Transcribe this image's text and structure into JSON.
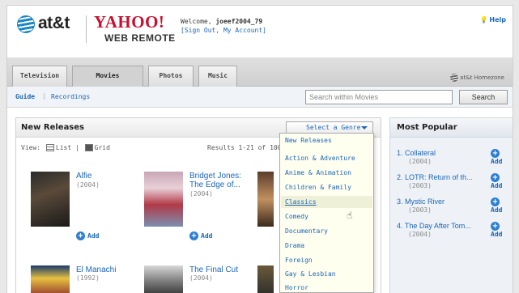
{
  "header": {
    "att_logo": "at&t",
    "yahoo_logo": "YAHOO!",
    "product": "WEB REMOTE",
    "welcome_prefix": "Welcome, ",
    "username": "joeef2004_79",
    "account_links": "[Sign Out, My Account]",
    "help": "Help"
  },
  "tabs": [
    {
      "label": "Television"
    },
    {
      "label": "Movies"
    },
    {
      "label": "Photos"
    },
    {
      "label": "Music"
    }
  ],
  "homezone": "at&t Homezone",
  "subnav": {
    "guide": "Guide",
    "separator": "|",
    "recordings": "Recordings",
    "search_placeholder": "Search within Movies",
    "search_button": "Search"
  },
  "releases": {
    "title": "New Releases",
    "genre_button": "Select a Genre",
    "view_label": "View:",
    "list_label": "List",
    "grid_label": "Grid",
    "results": "Results 1-21 of 100",
    "add_label": "Add",
    "movies": [
      {
        "title": "Alfie",
        "year": "(2004)"
      },
      {
        "title": "Bridget Jones: The Edge of...",
        "year": "(2004)"
      },
      {
        "title": "El Manachi",
        "year": "(1992)"
      },
      {
        "title": "The Final Cut",
        "year": "(2004)"
      }
    ]
  },
  "genres": {
    "items": [
      "New Releases",
      "Action & Adventure",
      "Anime & Animation",
      "Children & Family",
      "Classics",
      "Comedy",
      "Documentary",
      "Drama",
      "Foreign",
      "Gay & Lesbian",
      "Horror"
    ],
    "highlighted": "Classics"
  },
  "popular": {
    "title": "Most Popular",
    "add_label": "Add",
    "items": [
      {
        "title": "1. Collateral",
        "year": "(2004)"
      },
      {
        "title": "2. LOTR: Return of th...",
        "year": "(2003)"
      },
      {
        "title": "3. Mystic River",
        "year": "(2003)"
      },
      {
        "title": "4. The Day After Tom...",
        "year": "(2004)"
      }
    ]
  },
  "colors": {
    "link": "#1b66b5",
    "yahoo_red": "#c8102e",
    "add_icon": "#2d7fd1"
  }
}
